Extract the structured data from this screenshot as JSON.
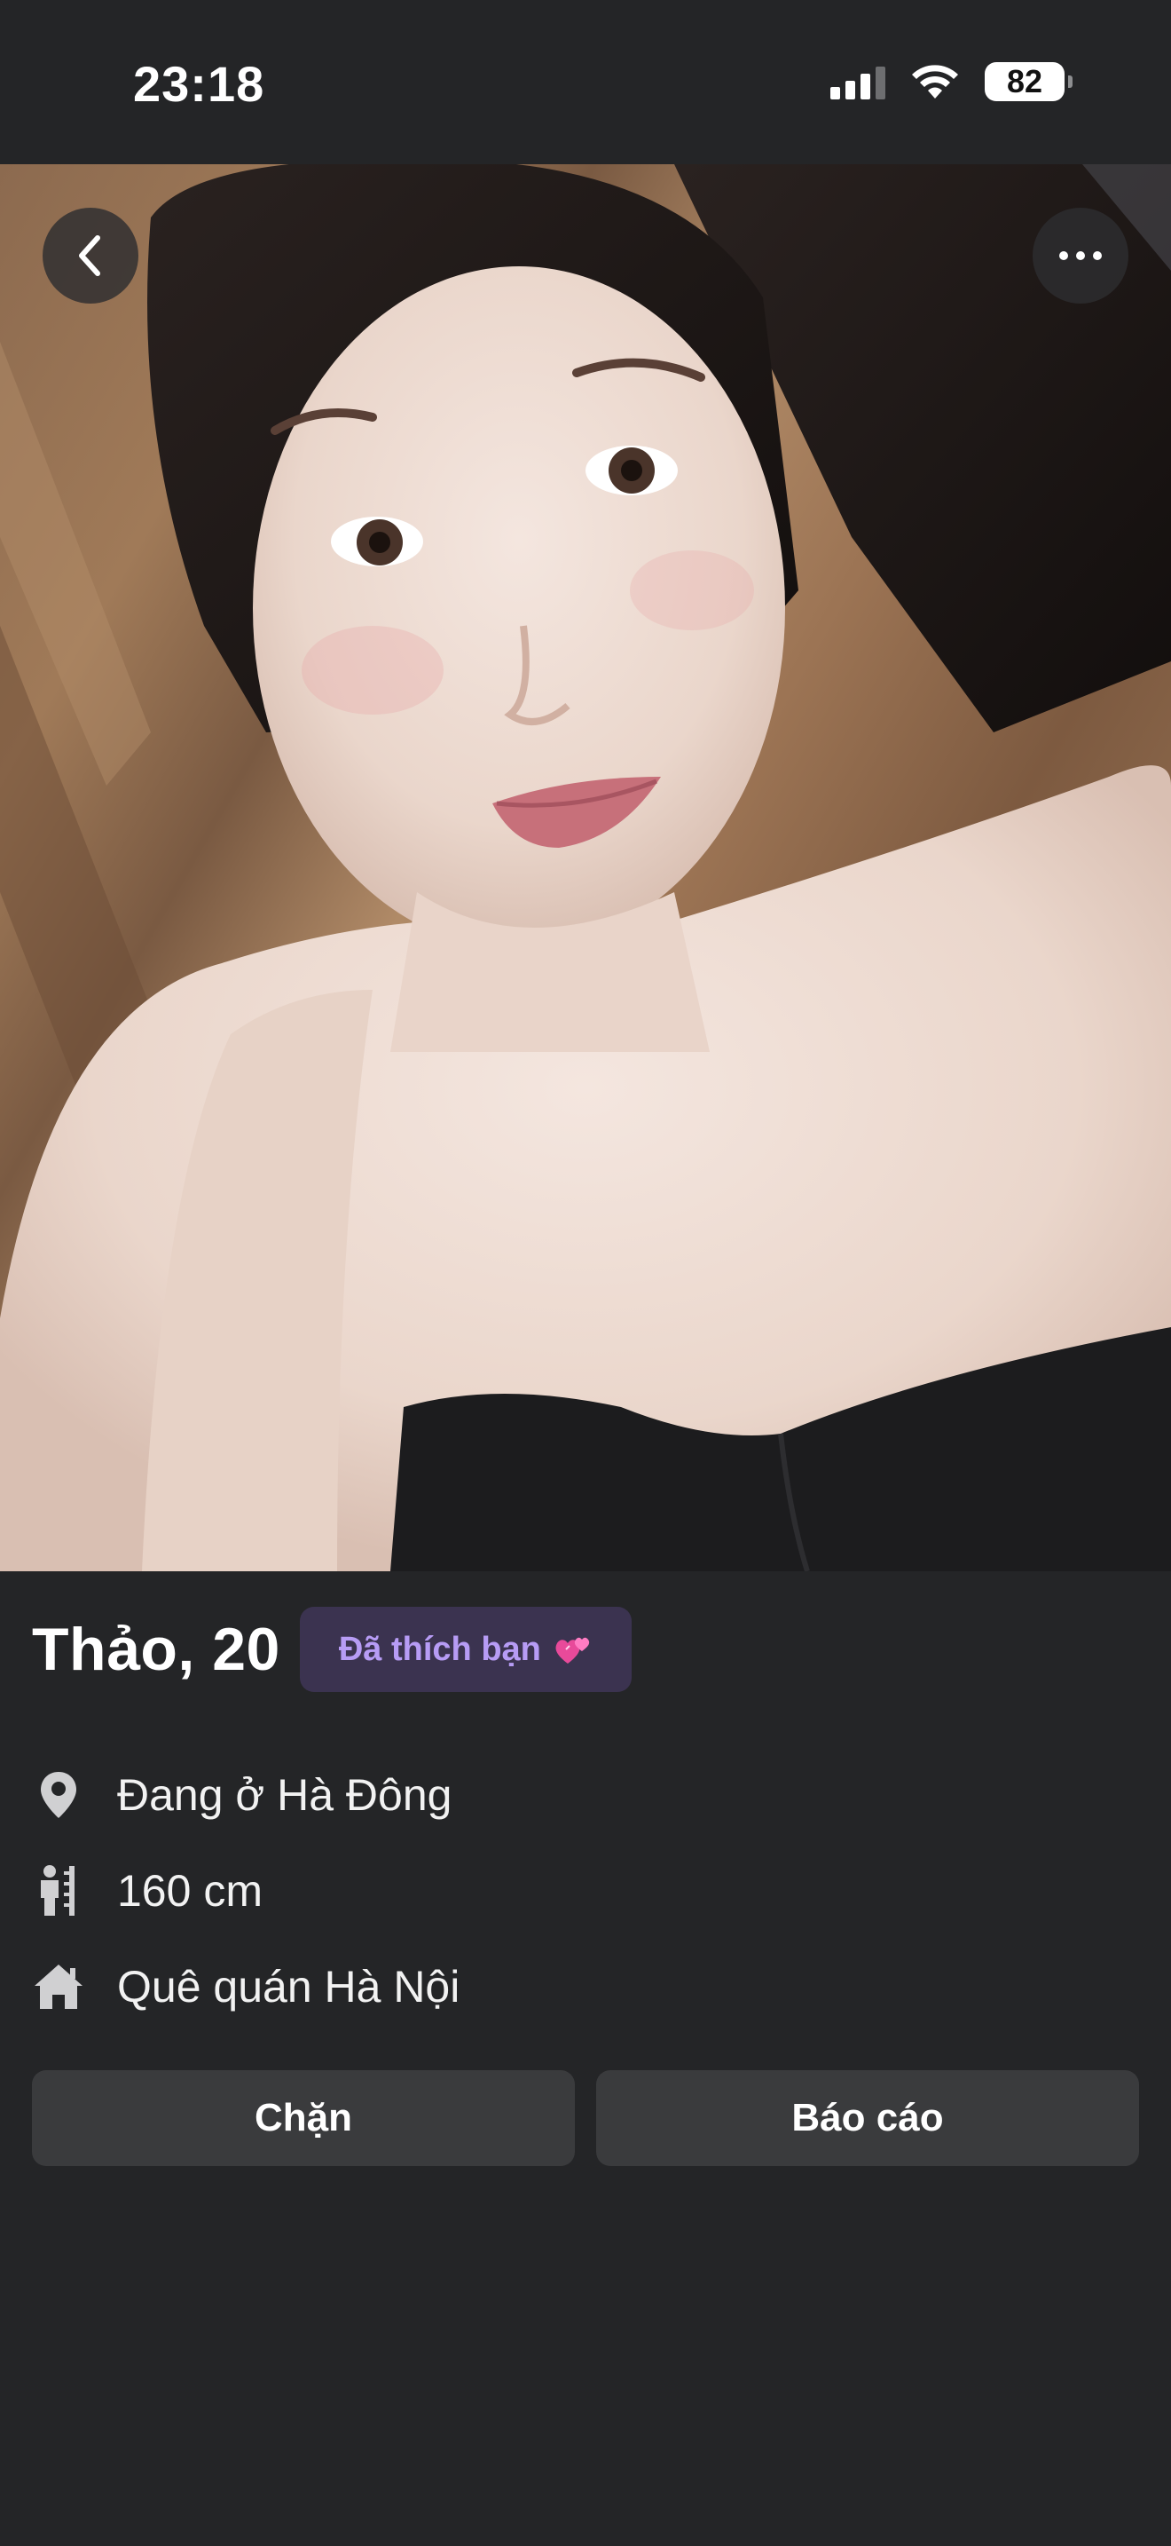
{
  "status_bar": {
    "time": "23:18",
    "battery": "82",
    "icons": [
      "signal-icon",
      "wifi-icon",
      "battery-icon"
    ]
  },
  "header": {
    "back_icon": "chevron-left-icon",
    "more_icon": "more-horizontal-icon"
  },
  "profile": {
    "name_age": "Thảo, 20",
    "liked_badge": "Đã thích bạn",
    "liked_icon": "two-hearts-icon",
    "details": [
      {
        "icon": "location-pin-icon",
        "text": "Đang ở Hà Đông"
      },
      {
        "icon": "height-icon",
        "text": "160 cm"
      },
      {
        "icon": "home-icon",
        "text": "Quê quán Hà Nội"
      }
    ]
  },
  "actions": {
    "block_label": "Chặn",
    "report_label": "Báo cáo"
  },
  "colors": {
    "background": "#242527",
    "badge_bg": "#3b3350",
    "badge_text": "#b79cf5",
    "button_bg": "#3a3b3d",
    "icon_gray": "#d0d0d2"
  }
}
